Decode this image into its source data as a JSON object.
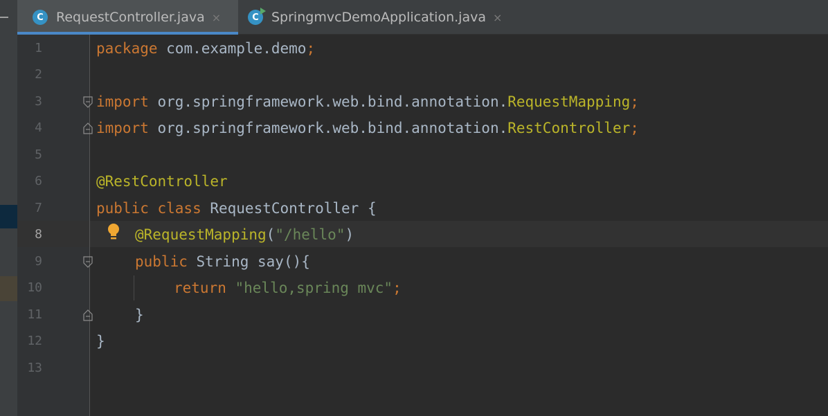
{
  "tabs": [
    {
      "label": "RequestController.java",
      "icon": "java-class-icon",
      "icon_letter": "C",
      "active": true
    },
    {
      "label": "SpringmvcDemoApplication.java",
      "icon": "java-runnable-class-icon",
      "icon_letter": "C",
      "active": false
    }
  ],
  "close_glyph": "×",
  "line_numbers": [
    "1",
    "2",
    "3",
    "4",
    "5",
    "6",
    "7",
    "8",
    "9",
    "10",
    "11",
    "12",
    "13"
  ],
  "current_line": "8",
  "code": {
    "l1_kw": "package",
    "l1_rest": " com.example.demo",
    "l1_semi": ";",
    "l3_kw": "import",
    "l3_pkg": " org.springframework.web.bind.annotation.",
    "l3_cls": "RequestMapping",
    "l3_semi": ";",
    "l4_kw": "import",
    "l4_pkg": " org.springframework.web.bind.annotation.",
    "l4_cls": "RestController",
    "l4_semi": ";",
    "l6_an": "@RestController",
    "l7_kw1": "public",
    "l7_kw2": " class",
    "l7_cls": " RequestController",
    "l7_brace": " {",
    "l8_an": "@RequestMapping",
    "l8_open": "(",
    "l8_str": "\"/hello\"",
    "l8_close": ")",
    "l9_kw": "public",
    "l9_type": " String",
    "l9_meth": " say",
    "l9_rest": "(){",
    "l10_kw": "return",
    "l10_str": " \"hello,spring mvc\"",
    "l10_semi": ";",
    "l11_brace": "}",
    "l12_brace": "}"
  },
  "colors": {
    "keyword": "#cc7832",
    "annotation": "#bbb529",
    "string": "#6a8759",
    "text": "#a9b7c6",
    "background": "#2b2b2b"
  }
}
